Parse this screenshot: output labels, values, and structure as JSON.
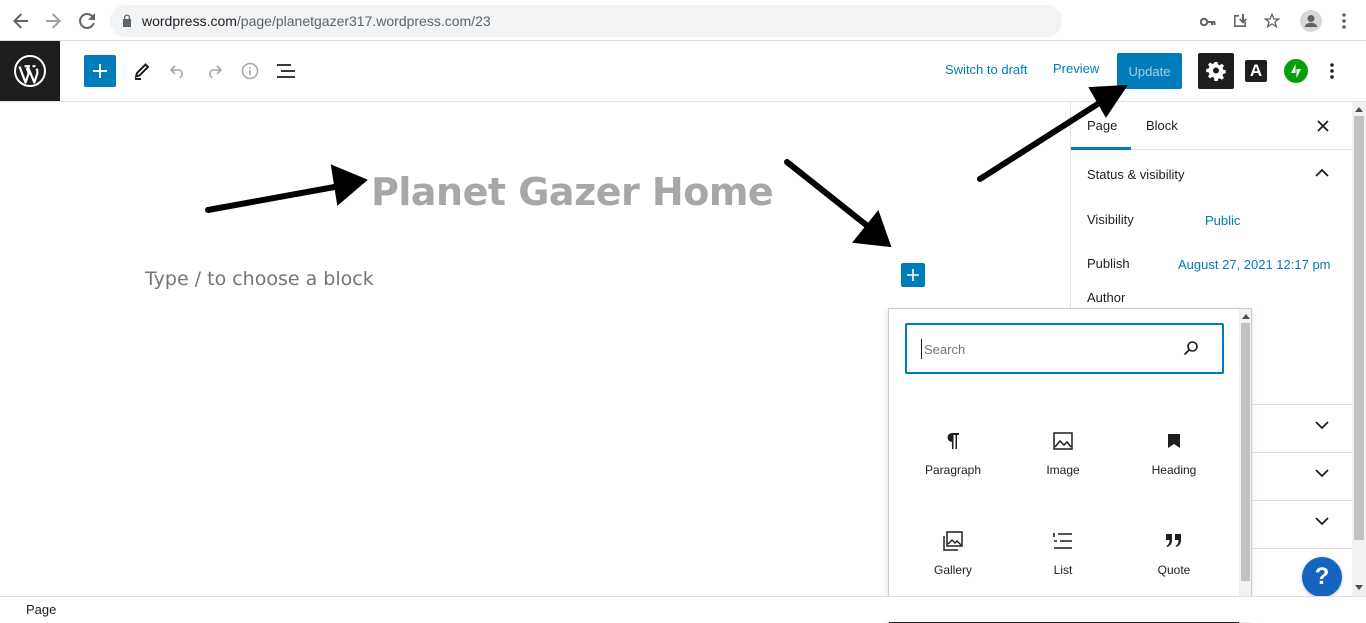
{
  "browser": {
    "url_host": "wordpress.com",
    "url_path": "/page/planetgazer317.wordpress.com/23"
  },
  "header": {
    "switch_to_draft": "Switch to draft",
    "preview": "Preview",
    "update": "Update",
    "amp_label": "A"
  },
  "editor": {
    "title": "Planet Gazer Home",
    "placeholder": "Type / to choose a block"
  },
  "sidebar": {
    "tabs": [
      "Page",
      "Block"
    ],
    "status_title": "Status & visibility",
    "visibility_label": "Visibility",
    "visibility_value": "Public",
    "publish_label": "Publish",
    "publish_value": "August 27, 2021 12:17 pm",
    "author_label": "Author"
  },
  "inserter": {
    "search_placeholder": "Search",
    "blocks": [
      {
        "label": "Paragraph",
        "icon": "paragraph-icon"
      },
      {
        "label": "Image",
        "icon": "image-icon"
      },
      {
        "label": "Heading",
        "icon": "heading-icon"
      },
      {
        "label": "Gallery",
        "icon": "gallery-icon"
      },
      {
        "label": "List",
        "icon": "list-icon"
      },
      {
        "label": "Quote",
        "icon": "quote-icon"
      }
    ]
  },
  "footer": {
    "breadcrumb": "Page"
  },
  "help": {
    "label": "?"
  },
  "colors": {
    "accent": "#007cba",
    "dark": "#1e1e1e",
    "jetpack": "#069e08",
    "help": "#1565c0"
  }
}
